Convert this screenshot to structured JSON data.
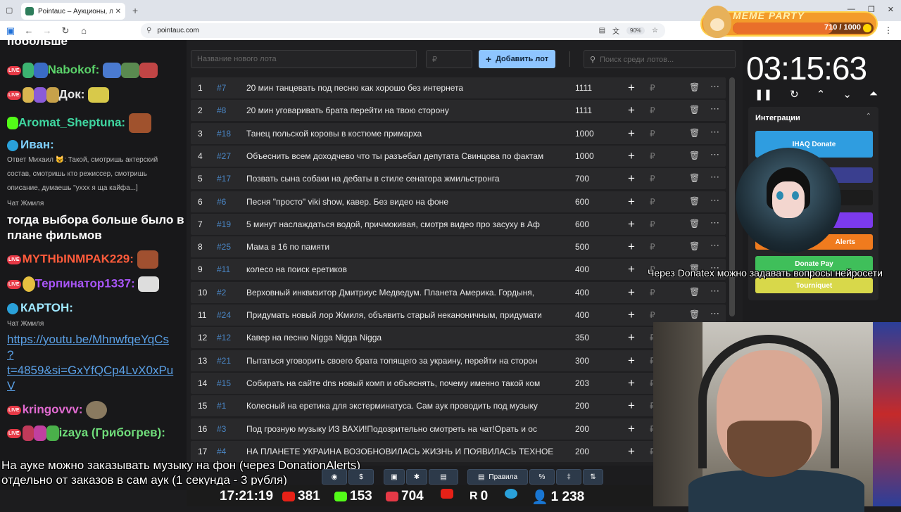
{
  "browser": {
    "tab_title": "Pointauc – Аукционы, лотереи",
    "url": "pointauc.com",
    "zoom": "90%"
  },
  "meme_party": {
    "title": "MEME PARTY",
    "progress": "710 / 1000",
    "progress_fraction": 0.71
  },
  "chat": {
    "lines": [
      {
        "text": "побольше",
        "color": "#ffffff"
      },
      {
        "text": "Nabokof:",
        "color": "#5bd36a"
      },
      {
        "text": "Док:",
        "color": "#e8e8e8"
      },
      {
        "text": "Aromat_Sheptuna:",
        "color": "#3fd6a0"
      },
      {
        "text": "Иван:",
        "color": "#7fd0ff"
      },
      {
        "text": "Ответ Михаил 😺: Такой, смотришь актерский",
        "color": "#bbbbbb"
      },
      {
        "text": "состав, смотришь кто режиссер, смотришь",
        "color": "#bbbbbb"
      },
      {
        "text": "описание, думаешь \"ухxx я ща кайфа...]",
        "color": "#bbbbbb"
      },
      {
        "text": "Чат Жмиля",
        "color": "#aaaaaa"
      },
      {
        "text": "тогда выбора больше было в",
        "color": "#ffffff"
      },
      {
        "text": "плане фильмов",
        "color": "#ffffff"
      },
      {
        "text": "MYTHbINMPAK229:",
        "color": "#ff5b3b"
      },
      {
        "text": "Терпинатор1337:",
        "color": "#a855f7"
      },
      {
        "text": "КАРТОН:",
        "color": "#9fe8ff"
      },
      {
        "text": "Чат Жмиля",
        "color": "#aaaaaa"
      },
      {
        "text": "https://youtu.be/MhnwfqeYqCs",
        "color": "#5aa0e6"
      },
      {
        "text": "?",
        "color": "#5aa0e6"
      },
      {
        "text": "t=4859&si=GxYfQCp4LvX0xPu",
        "color": "#5aa0e6"
      },
      {
        "text": "V",
        "color": "#5aa0e6"
      },
      {
        "text": "kringovvv:",
        "color": "#e26bd2"
      },
      {
        "text": "izaya (Грибогрев):",
        "color": "#6fdc7a"
      }
    ]
  },
  "main": {
    "new_lot_placeholder": "Название нового лота",
    "price_placeholder": "₽",
    "add_lot_label": "Добавить лот",
    "search_placeholder": "Поиск среди лотов...",
    "lots": [
      {
        "num": "1",
        "id": "#7",
        "name": "20 мин танцевать под песню как хорошо без интернета",
        "amount": "1111"
      },
      {
        "num": "2",
        "id": "#8",
        "name": "20 мин уговаривать брата перейти на твою сторону",
        "amount": "1111"
      },
      {
        "num": "3",
        "id": "#18",
        "name": "Танец польской коровы в костюме примарха",
        "amount": "1000"
      },
      {
        "num": "4",
        "id": "#27",
        "name": "Объеснить всем доходчево что ты разъебал депутата Свинцова по фактам",
        "amount": "1000"
      },
      {
        "num": "5",
        "id": "#17",
        "name": "Позвать сына собаки на дебаты в стиле сенатора жмильстронга",
        "amount": "700"
      },
      {
        "num": "6",
        "id": "#6",
        "name": "Песня \"просто\" viki show, кавер. Без видео на фоне",
        "amount": "600"
      },
      {
        "num": "7",
        "id": "#19",
        "name": "5 минут наслаждаться водой, причмокивая, смотря видео про засуху в Аф",
        "amount": "600"
      },
      {
        "num": "8",
        "id": "#25",
        "name": "Мама в 16 по памяти",
        "amount": "500"
      },
      {
        "num": "9",
        "id": "#11",
        "name": "колесо на поиск еретиков",
        "amount": "400"
      },
      {
        "num": "10",
        "id": "#2",
        "name": "Верховный инквизитор Дмитриус Медведум. Планета Америка. Гордыня, ",
        "amount": "400"
      },
      {
        "num": "11",
        "id": "#24",
        "name": "Придумать новый лор Жмиля, объявить старый неканоничным, придумати",
        "amount": "400"
      },
      {
        "num": "12",
        "id": "#12",
        "name": "Кавер на песню Nigga Nigga Nigga",
        "amount": "350"
      },
      {
        "num": "13",
        "id": "#21",
        "name": "Пытаться уговорить своего брата топящего за украину, перейти на сторон",
        "amount": "300"
      },
      {
        "num": "14",
        "id": "#15",
        "name": "Собирать на сайте dns новый комп и объяснять, почему именно такой ком",
        "amount": "203"
      },
      {
        "num": "15",
        "id": "#1",
        "name": "Колесный на еретика для экстерминатуса. Сам аук проводить под музыку",
        "amount": "200"
      },
      {
        "num": "16",
        "id": "#3",
        "name": "Под грозную музыку ИЗ ВАХИ!Подозрительно смотреть на чат!Орать и ос",
        "amount": "200"
      },
      {
        "num": "17",
        "id": "#4",
        "name": "НА ПЛАНЕТЕ УКРАИНА ВОЗОБНОВИЛАСЬ ЖИЗНЬ И ПОЯВИЛАСЬ ТЕХНОЕ",
        "amount": "200"
      }
    ]
  },
  "timer": {
    "value": "03:15:63"
  },
  "integrations": {
    "title": "Интеграции",
    "buttons": [
      {
        "label": "IHAQ Donate",
        "color": "#2f9de0"
      },
      {
        "label": "",
        "color": "#3a3f8f"
      },
      {
        "label": "",
        "color": "#1c1c1c"
      },
      {
        "label": "",
        "color": "#7c3aed"
      },
      {
        "label": "Alerts",
        "color": "#f07b1e"
      },
      {
        "label": "Donate Pay",
        "color": "#3fbf5a"
      },
      {
        "label": "Tourniquet",
        "color": "#d8d84a"
      }
    ]
  },
  "overlay": {
    "donatex_text": "Через Donatex можно задавать вопросы нейросети",
    "bottom_line1": "На ауке можно заказывать музыку на фон (через DonationAlerts)",
    "bottom_line2": "отдельно от заказов в сам аук (1 секунда - 3 рубля)"
  },
  "toolbar": {
    "rules_label": "Правила"
  },
  "status": {
    "time": "17:21:19",
    "youtube": "381",
    "kick": "153",
    "live": "704",
    "rumble": "0",
    "viewers": "1 238"
  }
}
